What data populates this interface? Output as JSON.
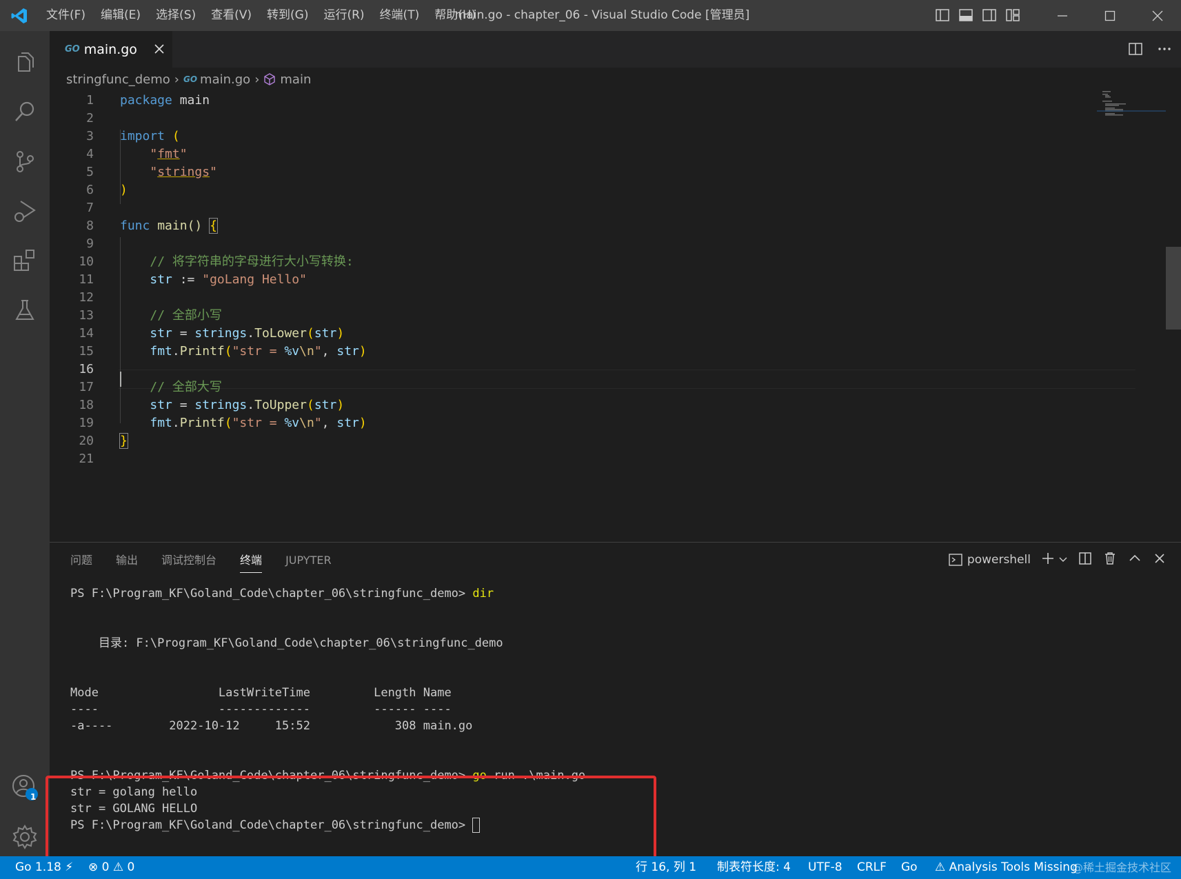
{
  "window": {
    "title": "main.go - chapter_06 - Visual Studio Code [管理员]",
    "menu": [
      "文件(F)",
      "编辑(E)",
      "选择(S)",
      "查看(V)",
      "转到(G)",
      "运行(R)",
      "终端(T)",
      "帮助(H)"
    ]
  },
  "tab": {
    "filename": "main.go",
    "icon_text": "GO"
  },
  "breadcrumb": {
    "folder": "stringfunc_demo",
    "file": "main.go",
    "symbol": "main"
  },
  "code": {
    "line_numbers": [
      "1",
      "2",
      "3",
      "4",
      "5",
      "6",
      "7",
      "8",
      "9",
      "10",
      "11",
      "12",
      "13",
      "14",
      "15",
      "16",
      "17",
      "18",
      "19",
      "20",
      "21"
    ],
    "active_line": "16",
    "l1_kw": "package",
    "l1_name": "main",
    "l3_kw": "import",
    "l3_paren": "(",
    "l4_q1": "\"",
    "l4_s": "fmt",
    "l4_q2": "\"",
    "l5_q1": "\"",
    "l5_s": "strings",
    "l5_q2": "\"",
    "l6_paren": ")",
    "l8_kw": "func",
    "l8_fn": "main",
    "l8_parens": "()",
    "l8_brace": "{",
    "l10_comment": "// 将字符串的字母进行大小写转换:",
    "l11_var": "str",
    "l11_op": ":=",
    "l11_str": "\"goLang Hello\"",
    "l13_comment": "// 全部小写",
    "l14_var": "str",
    "l14_op": "=",
    "l14_pkg": "strings",
    "l14_fn": "ToLower",
    "l14_open": "(",
    "l14_arg": "str",
    "l14_close": ")",
    "l15_pkg": "fmt",
    "l15_fn": "Printf",
    "l15_open": "(",
    "l15_s1": "\"str = ",
    "l15_fmt": "%v",
    "l15_esc": "\\n",
    "l15_s2": "\"",
    "l15_comma": ", ",
    "l15_arg": "str",
    "l15_close": ")",
    "l17_comment": "// 全部大写",
    "l18_var": "str",
    "l18_op": "=",
    "l18_pkg": "strings",
    "l18_fn": "ToUpper",
    "l18_open": "(",
    "l18_arg": "str",
    "l18_close": ")",
    "l19_pkg": "fmt",
    "l19_fn": "Printf",
    "l19_open": "(",
    "l19_s1": "\"str = ",
    "l19_fmt": "%v",
    "l19_esc": "\\n",
    "l19_s2": "\"",
    "l19_comma": ", ",
    "l19_arg": "str",
    "l19_close": ")",
    "l20_brace": "}"
  },
  "panel": {
    "tabs": [
      "问题",
      "输出",
      "调试控制台",
      "终端",
      "JUPYTER"
    ],
    "active_tab": "终端",
    "shell": "powershell"
  },
  "terminal": {
    "prompt": "PS F:\\Program_KF\\Goland_Code\\chapter_06\\stringfunc_demo> ",
    "cmd1": "dir",
    "dir_label": "    目录: F:\\Program_KF\\Goland_Code\\chapter_06\\stringfunc_demo",
    "header": "Mode                 LastWriteTime         Length Name",
    "underline": "----                 -------------         ------ ----",
    "row": "-a----        2022-10-12     15:52            308 main.go",
    "cmd2_go": "go",
    "cmd2_rest": " run .\\main.go",
    "out1": "str = golang hello",
    "out2": "str = GOLANG HELLO"
  },
  "statusbar": {
    "go_version": "Go 1.18",
    "errors": "0",
    "warnings": "0",
    "position": "行 16, 列 1",
    "indent": "制表符长度: 4",
    "encoding": "UTF-8",
    "eol": "CRLF",
    "language": "Go",
    "analysis": "Analysis Tools Missing",
    "watermark": "@稀土掘金技术社区"
  },
  "accounts_badge": "1",
  "colors": {
    "accent": "#007acc",
    "highlight_box": "#e02e2e"
  }
}
